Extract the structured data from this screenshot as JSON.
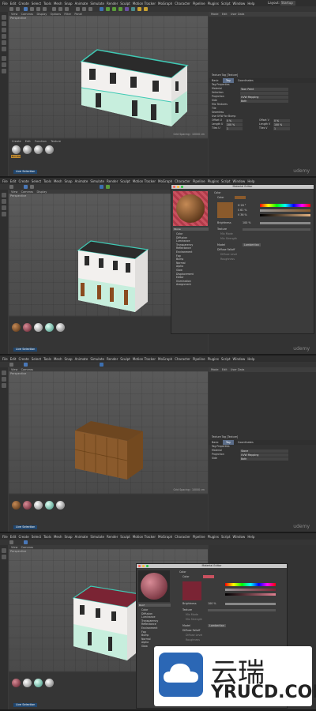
{
  "menu": [
    "File",
    "Edit",
    "Create",
    "Select",
    "Tools",
    "Mesh",
    "Snap",
    "Animate",
    "Simulate",
    "Render",
    "Sculpt",
    "Motion Tracker",
    "MoGraph",
    "Character",
    "Pipeline",
    "Plugins",
    "Script",
    "Window",
    "Help"
  ],
  "layout_label": "Layout:",
  "layout_value": "Startup",
  "viewport_menu": [
    "View",
    "Cameras",
    "Display",
    "Options",
    "Filter",
    "Panel"
  ],
  "viewport_label": "Perspective",
  "grid_spacing": "Grid Spacing : 10000 cm",
  "material_menu": [
    "Create",
    "Edit",
    "Function",
    "Texture"
  ],
  "live_selection": "Live Selection",
  "attr_menu": [
    "Mode",
    "Edit",
    "User Data"
  ],
  "attr_title": "Texture Tag [Texture]",
  "attr_tabs": [
    "Basic",
    "Tag",
    "Coordinates"
  ],
  "tag_properties": "Tag Properties",
  "attr_rows": [
    {
      "label": "Material",
      "value": "Toon Paint"
    },
    {
      "label": "Selection",
      "value": ""
    },
    {
      "label": "Projection",
      "value": "UVW Mapping"
    },
    {
      "label": "Side",
      "value": "Both"
    },
    {
      "label": "Mix Textures",
      "value": ""
    },
    {
      "label": "Tile",
      "value": ""
    },
    {
      "label": "Seamless",
      "value": ""
    },
    {
      "label": "Use UVW for Bump",
      "value": ""
    },
    {
      "label": "Offset U",
      "value": "0 %"
    },
    {
      "label": "Length U",
      "value": "100 %"
    },
    {
      "label": "Tiles U",
      "value": "1"
    }
  ],
  "attr_rows_right": [
    {
      "label": "Offset V",
      "value": "0 %"
    },
    {
      "label": "Length V",
      "value": "100 %"
    },
    {
      "label": "Tiles V",
      "value": "1"
    }
  ],
  "material_editor_title": "Material Editor",
  "material_name": "Stone",
  "material_name_4": "Roof",
  "channels": [
    "Color",
    "Diffusion",
    "Luminance",
    "Transparency",
    "Reflectance",
    "Environment",
    "Fog",
    "Bump",
    "Normal",
    "Alpha",
    "Glow",
    "Displacement",
    "Editor",
    "Illumination",
    "Assignment"
  ],
  "color_section": "Color",
  "color_label": "Color",
  "brightness_label": "Brightness",
  "brightness_value": "100 %",
  "texture_label": "Texture",
  "mix_mode": "Mix Mode",
  "mix_strength": "Mix Strength",
  "model_label": "Model",
  "model_value": "Lambertian",
  "diffuse_falloff": "Diffuse Falloff",
  "diffuse_level": "Diffuse Level",
  "roughness": "Roughness",
  "rgb_values": [
    "H 28 °",
    "S 61 %",
    "V 36 %"
  ],
  "material_names_row1": [
    "Toon Pai",
    "Mat",
    "Mat",
    "Mat"
  ],
  "watermark_zh": "云瑞",
  "watermark_en": "YRUCD.COM",
  "udemy": "udemy",
  "colors": {
    "wall": "#f2f0ee",
    "trim_teal": "#3fc9b4",
    "lower_mint": "#c7eedd",
    "door_brown": "#8a4b1f",
    "roof_dark": "#2b2b2b",
    "roof_red": "#7a2434",
    "stone_brown": "#8a5a2c",
    "selection_blue": "#20466e"
  }
}
